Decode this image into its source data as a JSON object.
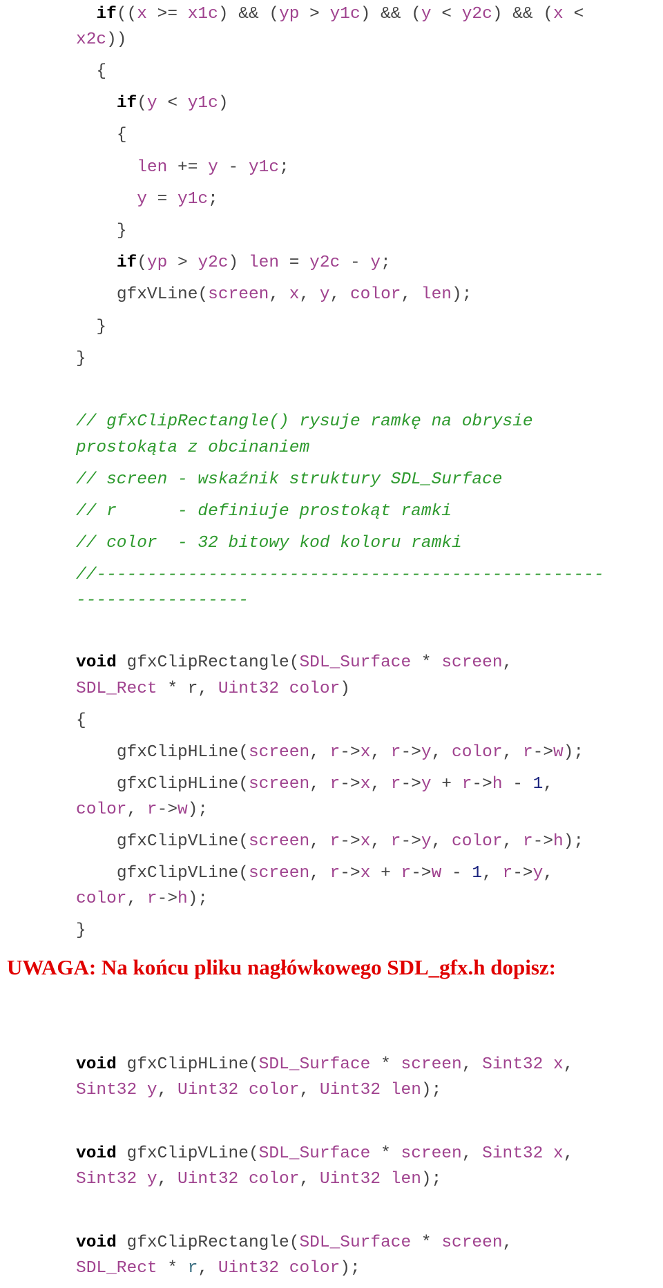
{
  "colors": {
    "keyword": "#000000",
    "identifier": "#a0438f",
    "plain": "#444444",
    "number": "#1a237e",
    "comment": "#2e9a2e",
    "warning": "#e00000"
  },
  "code_top": [
    {
      "indent": "  ",
      "tokens": [
        {
          "c": "kw",
          "t": "if"
        },
        {
          "c": "g",
          "t": "(("
        },
        {
          "c": "p",
          "t": "x"
        },
        {
          "c": "g",
          "t": " >= "
        },
        {
          "c": "p",
          "t": "x1c"
        },
        {
          "c": "g",
          "t": ") && ("
        },
        {
          "c": "p",
          "t": "yp"
        },
        {
          "c": "g",
          "t": " > "
        },
        {
          "c": "p",
          "t": "y1c"
        },
        {
          "c": "g",
          "t": ") && ("
        },
        {
          "c": "p",
          "t": "y"
        },
        {
          "c": "g",
          "t": " < "
        },
        {
          "c": "p",
          "t": "y2c"
        },
        {
          "c": "g",
          "t": ") && ("
        },
        {
          "c": "p",
          "t": "x"
        },
        {
          "c": "g",
          "t": " <"
        }
      ]
    },
    {
      "indent": "",
      "tokens": [
        {
          "c": "p",
          "t": "x2c"
        },
        {
          "c": "g",
          "t": "))"
        }
      ]
    },
    {
      "indent": "  ",
      "tokens": [
        {
          "c": "g",
          "t": "{"
        }
      ]
    },
    {
      "indent": "    ",
      "tokens": [
        {
          "c": "kw",
          "t": "if"
        },
        {
          "c": "g",
          "t": "("
        },
        {
          "c": "p",
          "t": "y"
        },
        {
          "c": "g",
          "t": " < "
        },
        {
          "c": "p",
          "t": "y1c"
        },
        {
          "c": "g",
          "t": ")"
        }
      ]
    },
    {
      "indent": "    ",
      "tokens": [
        {
          "c": "g",
          "t": "{"
        }
      ]
    },
    {
      "indent": "      ",
      "tokens": [
        {
          "c": "p",
          "t": "len"
        },
        {
          "c": "g",
          "t": " += "
        },
        {
          "c": "p",
          "t": "y"
        },
        {
          "c": "g",
          "t": " - "
        },
        {
          "c": "p",
          "t": "y1c"
        },
        {
          "c": "g",
          "t": ";"
        }
      ]
    },
    {
      "indent": "      ",
      "tokens": [
        {
          "c": "p",
          "t": "y"
        },
        {
          "c": "g",
          "t": " = "
        },
        {
          "c": "p",
          "t": "y1c"
        },
        {
          "c": "g",
          "t": ";"
        }
      ]
    },
    {
      "indent": "    ",
      "tokens": [
        {
          "c": "g",
          "t": "}"
        }
      ]
    },
    {
      "indent": "    ",
      "tokens": [
        {
          "c": "kw",
          "t": "if"
        },
        {
          "c": "g",
          "t": "("
        },
        {
          "c": "p",
          "t": "yp"
        },
        {
          "c": "g",
          "t": " > "
        },
        {
          "c": "p",
          "t": "y2c"
        },
        {
          "c": "g",
          "t": ") "
        },
        {
          "c": "p",
          "t": "len"
        },
        {
          "c": "g",
          "t": " = "
        },
        {
          "c": "p",
          "t": "y2c"
        },
        {
          "c": "g",
          "t": " - "
        },
        {
          "c": "p",
          "t": "y"
        },
        {
          "c": "g",
          "t": ";"
        }
      ]
    },
    {
      "indent": "    ",
      "tokens": [
        {
          "c": "g",
          "t": "gfxVLine("
        },
        {
          "c": "p",
          "t": "screen"
        },
        {
          "c": "g",
          "t": ", "
        },
        {
          "c": "p",
          "t": "x"
        },
        {
          "c": "g",
          "t": ", "
        },
        {
          "c": "p",
          "t": "y"
        },
        {
          "c": "g",
          "t": ", "
        },
        {
          "c": "p",
          "t": "color"
        },
        {
          "c": "g",
          "t": ", "
        },
        {
          "c": "p",
          "t": "len"
        },
        {
          "c": "g",
          "t": ");"
        }
      ]
    },
    {
      "indent": "  ",
      "tokens": [
        {
          "c": "g",
          "t": "}"
        }
      ]
    },
    {
      "indent": "",
      "tokens": [
        {
          "c": "g",
          "t": "}"
        }
      ]
    }
  ],
  "comments": [
    "// gfxClipRectangle() rysuje ramkę na obrysie",
    "prostokąta z obcinaniem",
    "// screen - wskaźnik struktury SDL_Surface",
    "// r      - definiuje prostokąt ramki",
    "// color  - 32 bitowy kod koloru ramki",
    "//--------------------------------------------------",
    "-----------------"
  ],
  "code_func": [
    {
      "indent": "",
      "tokens": [
        {
          "c": "kw",
          "t": "void"
        },
        {
          "c": "g",
          "t": " gfxClipRectangle("
        },
        {
          "c": "p",
          "t": "SDL_Surface"
        },
        {
          "c": "g",
          "t": " * "
        },
        {
          "c": "p",
          "t": "screen"
        },
        {
          "c": "g",
          "t": ","
        }
      ]
    },
    {
      "indent": "",
      "tokens": [
        {
          "c": "p",
          "t": "SDL_Rect"
        },
        {
          "c": "g",
          "t": " * r, "
        },
        {
          "c": "p",
          "t": "Uint32"
        },
        {
          "c": "g",
          "t": " "
        },
        {
          "c": "p",
          "t": "color"
        },
        {
          "c": "g",
          "t": ")"
        }
      ]
    },
    {
      "indent": "",
      "tokens": [
        {
          "c": "g",
          "t": "{"
        }
      ]
    },
    {
      "indent": "    ",
      "tokens": [
        {
          "c": "g",
          "t": "gfxClipHLine("
        },
        {
          "c": "p",
          "t": "screen"
        },
        {
          "c": "g",
          "t": ", "
        },
        {
          "c": "p",
          "t": "r"
        },
        {
          "c": "g",
          "t": "->"
        },
        {
          "c": "p",
          "t": "x"
        },
        {
          "c": "g",
          "t": ", "
        },
        {
          "c": "p",
          "t": "r"
        },
        {
          "c": "g",
          "t": "->"
        },
        {
          "c": "p",
          "t": "y"
        },
        {
          "c": "g",
          "t": ", "
        },
        {
          "c": "p",
          "t": "color"
        },
        {
          "c": "g",
          "t": ", "
        },
        {
          "c": "p",
          "t": "r"
        },
        {
          "c": "g",
          "t": "->"
        },
        {
          "c": "p",
          "t": "w"
        },
        {
          "c": "g",
          "t": ");"
        }
      ]
    },
    {
      "indent": "    ",
      "tokens": [
        {
          "c": "g",
          "t": "gfxClipHLine("
        },
        {
          "c": "p",
          "t": "screen"
        },
        {
          "c": "g",
          "t": ", "
        },
        {
          "c": "p",
          "t": "r"
        },
        {
          "c": "g",
          "t": "->"
        },
        {
          "c": "p",
          "t": "x"
        },
        {
          "c": "g",
          "t": ", "
        },
        {
          "c": "p",
          "t": "r"
        },
        {
          "c": "g",
          "t": "->"
        },
        {
          "c": "p",
          "t": "y"
        },
        {
          "c": "g",
          "t": " + "
        },
        {
          "c": "p",
          "t": "r"
        },
        {
          "c": "g",
          "t": "->"
        },
        {
          "c": "p",
          "t": "h"
        },
        {
          "c": "g",
          "t": " - "
        },
        {
          "c": "n",
          "t": "1"
        },
        {
          "c": "g",
          "t": ","
        }
      ]
    },
    {
      "indent": "",
      "tokens": [
        {
          "c": "p",
          "t": "color"
        },
        {
          "c": "g",
          "t": ", "
        },
        {
          "c": "p",
          "t": "r"
        },
        {
          "c": "g",
          "t": "->"
        },
        {
          "c": "p",
          "t": "w"
        },
        {
          "c": "g",
          "t": ");"
        }
      ]
    },
    {
      "indent": "    ",
      "tokens": [
        {
          "c": "g",
          "t": "gfxClipVLine("
        },
        {
          "c": "p",
          "t": "screen"
        },
        {
          "c": "g",
          "t": ", "
        },
        {
          "c": "p",
          "t": "r"
        },
        {
          "c": "g",
          "t": "->"
        },
        {
          "c": "p",
          "t": "x"
        },
        {
          "c": "g",
          "t": ", "
        },
        {
          "c": "p",
          "t": "r"
        },
        {
          "c": "g",
          "t": "->"
        },
        {
          "c": "p",
          "t": "y"
        },
        {
          "c": "g",
          "t": ", "
        },
        {
          "c": "p",
          "t": "color"
        },
        {
          "c": "g",
          "t": ", "
        },
        {
          "c": "p",
          "t": "r"
        },
        {
          "c": "g",
          "t": "->"
        },
        {
          "c": "p",
          "t": "h"
        },
        {
          "c": "g",
          "t": ");"
        }
      ]
    },
    {
      "indent": "    ",
      "tokens": [
        {
          "c": "g",
          "t": "gfxClipVLine("
        },
        {
          "c": "p",
          "t": "screen"
        },
        {
          "c": "g",
          "t": ", "
        },
        {
          "c": "p",
          "t": "r"
        },
        {
          "c": "g",
          "t": "->"
        },
        {
          "c": "p",
          "t": "x"
        },
        {
          "c": "g",
          "t": " + "
        },
        {
          "c": "p",
          "t": "r"
        },
        {
          "c": "g",
          "t": "->"
        },
        {
          "c": "p",
          "t": "w"
        },
        {
          "c": "g",
          "t": " - "
        },
        {
          "c": "n",
          "t": "1"
        },
        {
          "c": "g",
          "t": ", "
        },
        {
          "c": "p",
          "t": "r"
        },
        {
          "c": "g",
          "t": "->"
        },
        {
          "c": "p",
          "t": "y"
        },
        {
          "c": "g",
          "t": ","
        }
      ]
    },
    {
      "indent": "",
      "tokens": [
        {
          "c": "p",
          "t": "color"
        },
        {
          "c": "g",
          "t": ", "
        },
        {
          "c": "p",
          "t": "r"
        },
        {
          "c": "g",
          "t": "->"
        },
        {
          "c": "p",
          "t": "h"
        },
        {
          "c": "g",
          "t": ");"
        }
      ]
    },
    {
      "indent": "",
      "tokens": [
        {
          "c": "g",
          "t": "}"
        }
      ]
    }
  ],
  "warning_heading": "UWAGA: Na końcu pliku nagłówkowego SDL_gfx.h dopisz:",
  "declarations": [
    {
      "indent": "",
      "tokens": [
        {
          "c": "kw",
          "t": "void"
        },
        {
          "c": "g",
          "t": " gfxClipHLine("
        },
        {
          "c": "p",
          "t": "SDL_Surface"
        },
        {
          "c": "g",
          "t": " * "
        },
        {
          "c": "p",
          "t": "screen"
        },
        {
          "c": "g",
          "t": ", "
        },
        {
          "c": "p",
          "t": "Sint32"
        },
        {
          "c": "g",
          "t": " "
        },
        {
          "c": "p",
          "t": "x"
        },
        {
          "c": "g",
          "t": ","
        }
      ]
    },
    {
      "indent": "",
      "tokens": [
        {
          "c": "p",
          "t": "Sint32"
        },
        {
          "c": "g",
          "t": " "
        },
        {
          "c": "p",
          "t": "y"
        },
        {
          "c": "g",
          "t": ", "
        },
        {
          "c": "p",
          "t": "Uint32"
        },
        {
          "c": "g",
          "t": " "
        },
        {
          "c": "p",
          "t": "color"
        },
        {
          "c": "g",
          "t": ", "
        },
        {
          "c": "p",
          "t": "Uint32"
        },
        {
          "c": "g",
          "t": " "
        },
        {
          "c": "p",
          "t": "len"
        },
        {
          "c": "g",
          "t": ");"
        }
      ]
    },
    {
      "indent": "",
      "tokens": [
        {
          "c": "kw",
          "t": "void"
        },
        {
          "c": "g",
          "t": " gfxClipVLine("
        },
        {
          "c": "p",
          "t": "SDL_Surface"
        },
        {
          "c": "g",
          "t": " * "
        },
        {
          "c": "p",
          "t": "screen"
        },
        {
          "c": "g",
          "t": ", "
        },
        {
          "c": "p",
          "t": "Sint32"
        },
        {
          "c": "g",
          "t": " "
        },
        {
          "c": "p",
          "t": "x"
        },
        {
          "c": "g",
          "t": ","
        }
      ]
    },
    {
      "indent": "",
      "tokens": [
        {
          "c": "p",
          "t": "Sint32"
        },
        {
          "c": "g",
          "t": " "
        },
        {
          "c": "p",
          "t": "y"
        },
        {
          "c": "g",
          "t": ", "
        },
        {
          "c": "p",
          "t": "Uint32"
        },
        {
          "c": "g",
          "t": " "
        },
        {
          "c": "p",
          "t": "color"
        },
        {
          "c": "g",
          "t": ", "
        },
        {
          "c": "p",
          "t": "Uint32"
        },
        {
          "c": "g",
          "t": " "
        },
        {
          "c": "p",
          "t": "len"
        },
        {
          "c": "g",
          "t": ");"
        }
      ]
    },
    {
      "indent": "",
      "tokens": [
        {
          "c": "kw",
          "t": "void"
        },
        {
          "c": "g",
          "t": " gfxClipRectangle("
        },
        {
          "c": "p",
          "t": "SDL_Surface"
        },
        {
          "c": "g",
          "t": " * "
        },
        {
          "c": "p",
          "t": "screen"
        },
        {
          "c": "g",
          "t": ","
        }
      ]
    },
    {
      "indent": "",
      "tokens": [
        {
          "c": "p",
          "t": "SDL_Rect"
        },
        {
          "c": "g",
          "t": " * "
        },
        {
          "c": "t",
          "t": "r"
        },
        {
          "c": "g",
          "t": ", "
        },
        {
          "c": "p",
          "t": "Uint32"
        },
        {
          "c": "g",
          "t": " "
        },
        {
          "c": "p",
          "t": "color"
        },
        {
          "c": "g",
          "t": ");"
        }
      ]
    }
  ]
}
